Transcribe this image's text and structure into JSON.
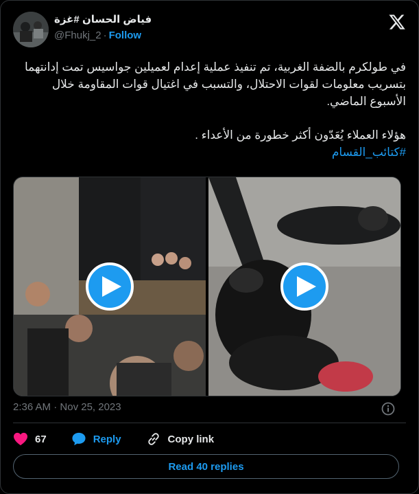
{
  "author": {
    "display_name": "فياض الحسان #غزة",
    "handle": "@Fhukj_2",
    "separator": "·",
    "follow_label": "Follow"
  },
  "tweet": {
    "paragraph1": "في طولكرم بالضفة الغربية، تم تنفيذ عملية إعدام لعميلين جواسيس تمت إدانتهما بتسريب معلومات لقوات الاحتلال، والتسبب في اغتيال قوات المقاومة خلال الأسبوع الماضي.",
    "paragraph2": "هؤلاء العملاء يُعَدّون أكثر خطورة من الأعداء .",
    "hashtag": "#كتائب_القسام"
  },
  "media": {
    "videos": [
      {
        "icon": "play-icon"
      },
      {
        "icon": "play-icon"
      }
    ]
  },
  "meta": {
    "time": "2:36 AM",
    "separator": "·",
    "date": "Nov 25, 2023"
  },
  "actions": {
    "like_count": "67",
    "reply_label": "Reply",
    "copy_label": "Copy link"
  },
  "read_replies_label": "Read 40 replies",
  "colors": {
    "accent": "#1d9bf0",
    "like": "#f91880",
    "text": "#e7e9ea",
    "muted": "#71767b",
    "border": "#2f3336"
  }
}
